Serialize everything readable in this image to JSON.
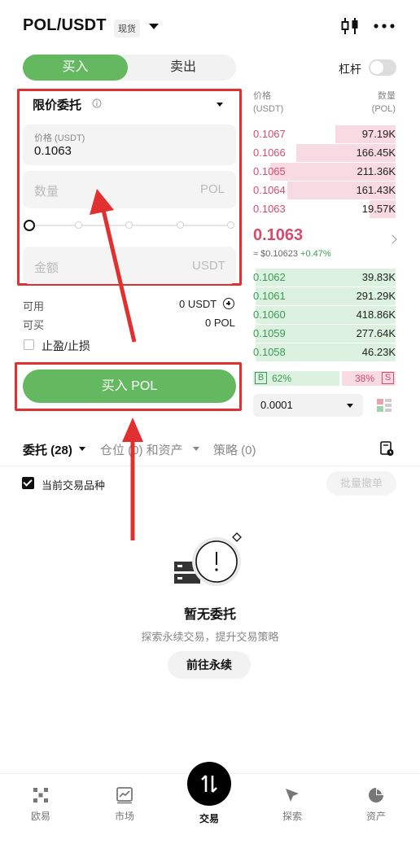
{
  "header": {
    "pair": "POL/USDT",
    "market_badge": "现货",
    "icons": {
      "chart": "candlestick-icon",
      "more": "more-dots-icon"
    }
  },
  "trade_tabs": {
    "buy": "买入",
    "sell": "卖出",
    "leverage_label": "杠杆"
  },
  "order_form": {
    "order_type": "限价委托",
    "price_label": "价格 (USDT)",
    "price_value": "0.1063",
    "quantity_placeholder": "数量",
    "quantity_unit": "POL",
    "amount_placeholder": "金额",
    "amount_unit": "USDT",
    "available_label": "可用",
    "available_value": "0 USDT",
    "buyable_label": "可买",
    "buyable_value": "0 POL",
    "tpsl_label": "止盈/止损",
    "submit_label": "买入 POL"
  },
  "order_book": {
    "price_header": "价格",
    "price_unit": "(USDT)",
    "qty_header": "数量",
    "qty_unit": "(POL)",
    "asks": [
      {
        "price": "0.1067",
        "qty": "97.19K",
        "depth": 0.42
      },
      {
        "price": "0.1066",
        "qty": "166.45K",
        "depth": 0.7
      },
      {
        "price": "0.1065",
        "qty": "211.36K",
        "depth": 0.88
      },
      {
        "price": "0.1064",
        "qty": "161.43K",
        "depth": 0.76
      },
      {
        "price": "0.1063",
        "qty": "19.57K",
        "depth": 0.18
      }
    ],
    "last_price": "0.1063",
    "last_price_usd": "≈ $0.10623",
    "last_change": "+0.47%",
    "bids": [
      {
        "price": "0.1062",
        "qty": "39.83K",
        "depth": 0.98
      },
      {
        "price": "0.1061",
        "qty": "291.29K",
        "depth": 0.98
      },
      {
        "price": "0.1060",
        "qty": "418.86K",
        "depth": 0.98
      },
      {
        "price": "0.1059",
        "qty": "277.64K",
        "depth": 0.98
      },
      {
        "price": "0.1058",
        "qty": "46.23K",
        "depth": 0.98
      }
    ],
    "buy_ratio_badge": "B",
    "buy_ratio": "62%",
    "sell_ratio": "38%",
    "sell_ratio_badge": "S",
    "depth_step": "0.0001"
  },
  "orders_section": {
    "tab_orders": "委托 (28)",
    "tab_positions": "仓位 (0) 和资产",
    "tab_strategies": "策略 (0)",
    "current_pair_filter": "当前交易品种",
    "batch_cancel": "批量撤单",
    "empty_title": "暂无委托",
    "empty_subtitle": "探索永续交易，提升交易策略",
    "go_button": "前往永续"
  },
  "bottom_nav": {
    "items": [
      {
        "label": "欧易",
        "icon": "okx-logo-icon"
      },
      {
        "label": "市场",
        "icon": "market-chart-icon"
      },
      {
        "label": "交易",
        "icon": "trade-arrows-icon"
      },
      {
        "label": "探索",
        "icon": "compass-icon"
      },
      {
        "label": "资产",
        "icon": "pie-chart-icon"
      }
    ]
  },
  "colors": {
    "buy_green": "#63b860",
    "ask_red": "#d44b6b",
    "bid_green": "#3a9a55",
    "annotation_red": "#e03030"
  }
}
